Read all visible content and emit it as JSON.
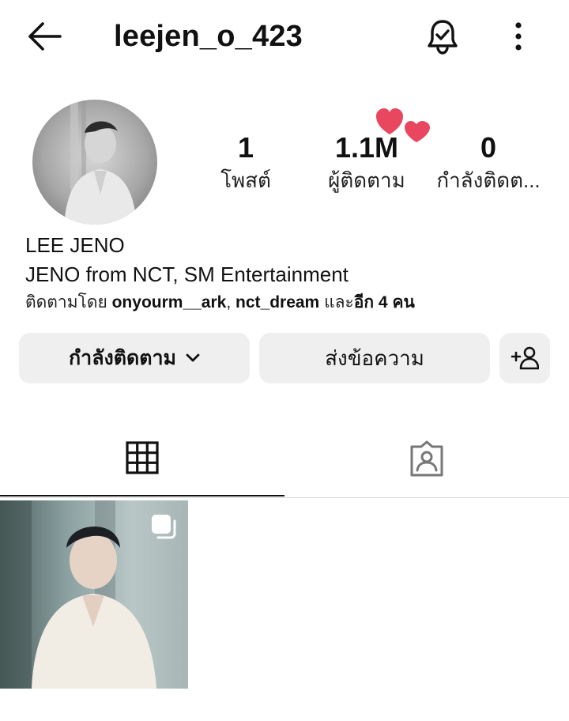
{
  "header": {
    "username": "leejen_o_423",
    "back_icon": "arrow-left-icon",
    "bell_icon": "bell-check-icon",
    "more_icon": "more-vertical-icon"
  },
  "stats": {
    "posts": {
      "value": "1",
      "label": "โพสต์"
    },
    "followers": {
      "value": "1.1M",
      "label": "ผู้ติดตาม"
    },
    "following": {
      "value": "0",
      "label": "กำลังติดต..."
    }
  },
  "bio": {
    "name": "LEE JENO",
    "text": "JENO from NCT, SM Entertainment",
    "followed_by_prefix": "ติดตามโดย ",
    "followed_by_user1": "onyourm__ark",
    "followed_by_sep": ", ",
    "followed_by_user2": "nct_dream",
    "followed_by_and": " และ",
    "followed_by_others": "อีก 4 คน"
  },
  "actions": {
    "following_label": "กำลังติดตาม",
    "message_label": "ส่งข้อความ",
    "suggest_icon": "add-person-icon"
  },
  "tabs": [
    {
      "name": "grid",
      "icon": "grid-icon",
      "active": true
    },
    {
      "name": "tagged",
      "icon": "tagged-person-icon",
      "active": false
    }
  ],
  "colors": {
    "heart": "#e8475f",
    "button_bg": "#efefef",
    "text": "#111111"
  }
}
